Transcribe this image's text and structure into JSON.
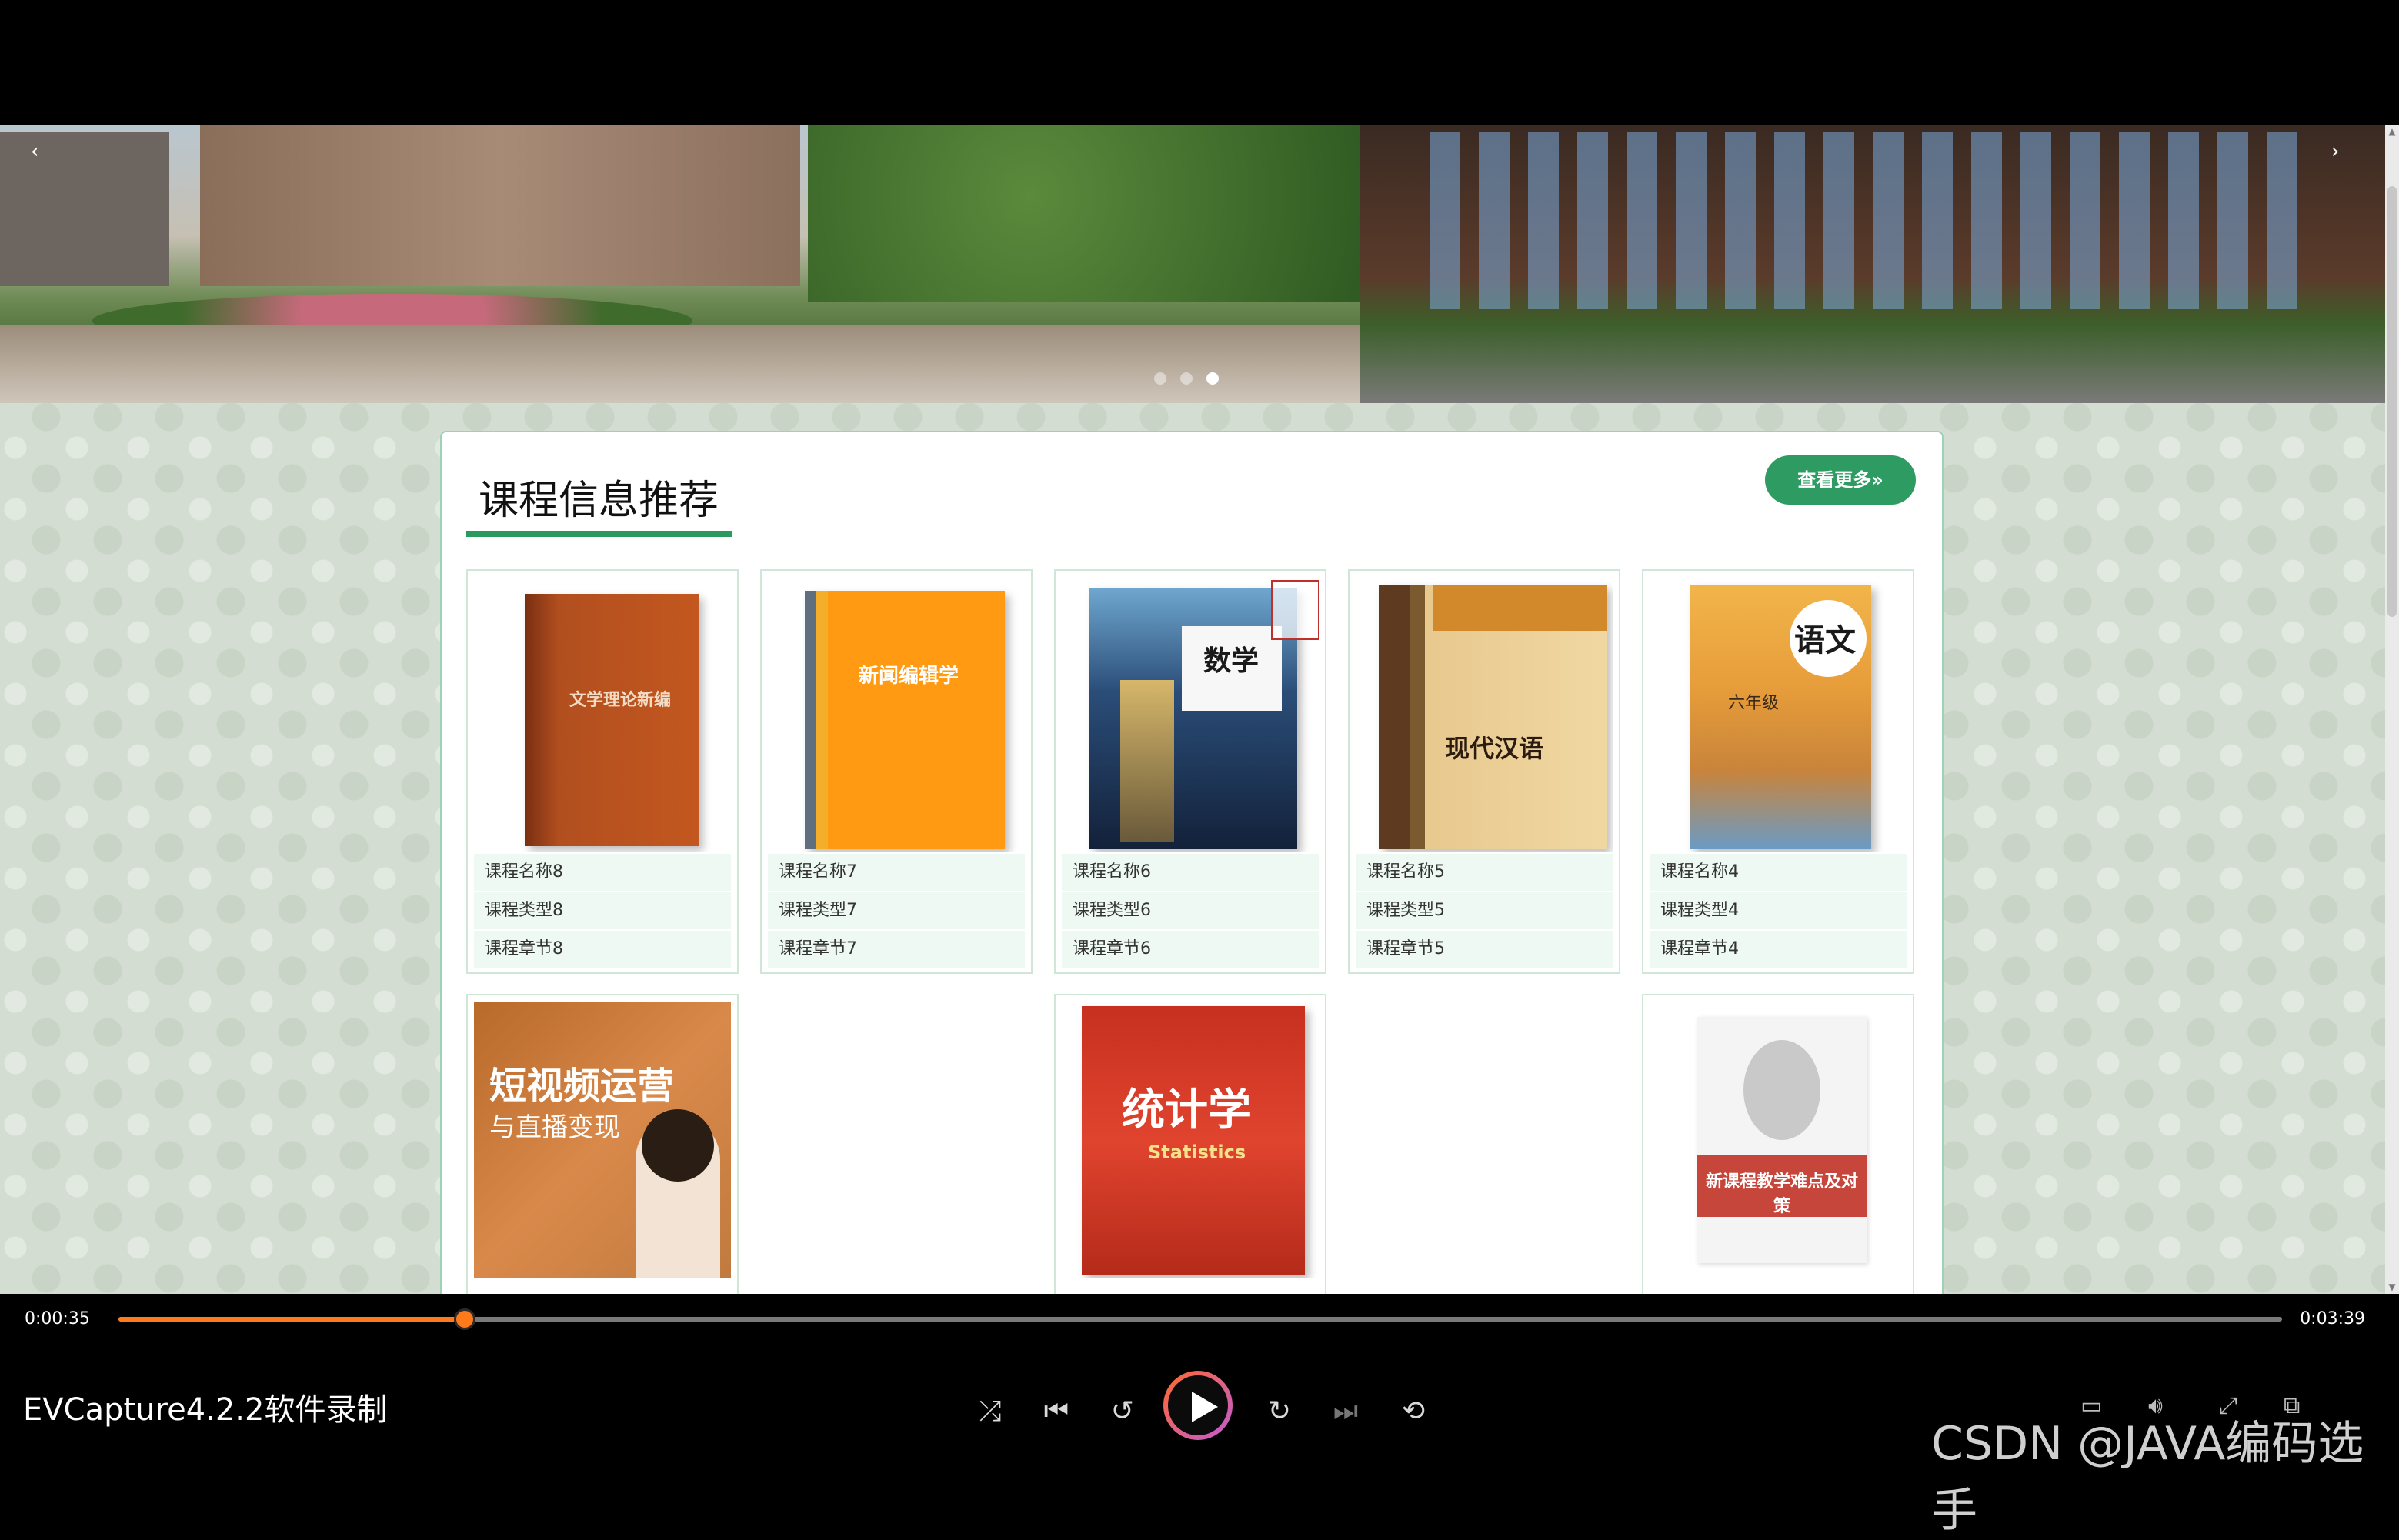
{
  "section": {
    "title": "课程信息推荐",
    "more_label": "查看更多»"
  },
  "banner": {
    "prev": "‹",
    "next": "›",
    "slide_count": 3,
    "active_slide": 3
  },
  "courses_row1": [
    {
      "name": "课程名称8",
      "type": "课程类型8",
      "chapter": "课程章节8",
      "cover_text": "文学理论新编"
    },
    {
      "name": "课程名称7",
      "type": "课程类型7",
      "chapter": "课程章节7",
      "cover_text": "新闻编辑学"
    },
    {
      "name": "课程名称6",
      "type": "课程类型6",
      "chapter": "课程章节6",
      "cover_text": "数学"
    },
    {
      "name": "课程名称5",
      "type": "课程类型5",
      "chapter": "课程章节5",
      "cover_text": "现代汉语"
    },
    {
      "name": "课程名称4",
      "type": "课程类型4",
      "chapter": "课程章节4",
      "cover_text": "语文",
      "cover_sub": "六年级"
    }
  ],
  "courses_row2": [
    {
      "cover_text": "短视频运营",
      "cover_sub": "与直播变现"
    },
    {
      "cover_text": "统计学",
      "cover_sub": "Statistics"
    },
    {
      "cover_text": "新课程教学难点及对策"
    }
  ],
  "player": {
    "time_elapsed": "0:00:35",
    "time_total": "0:03:39",
    "progress": 0.16,
    "app_name": "EVCapture4.2.2软件录制",
    "watermark": "CSDN @JAVA编码选手",
    "controls": [
      "shuffle-icon",
      "previous-icon",
      "rewind-10-icon",
      "play-icon",
      "forward-30-icon",
      "next-icon",
      "repeat-icon"
    ]
  }
}
